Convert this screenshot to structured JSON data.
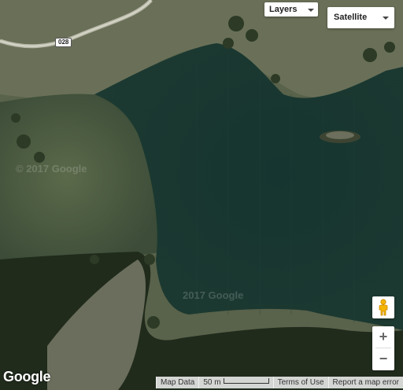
{
  "map": {
    "road_label": "028",
    "watermarks": [
      "© 2017 Google",
      "2017 Google"
    ],
    "map_type_control": {
      "selected": "Satellite"
    },
    "layers_control": {
      "label": "Layers"
    },
    "zoom": {
      "in_label": "+",
      "out_label": "−"
    },
    "logo": "Google",
    "footer": {
      "map_data": "Map Data",
      "scale_label": "50 m",
      "terms": "Terms of Use",
      "report": "Report a map error"
    },
    "colors": {
      "water": "#17342f",
      "land": "#5a6448",
      "forest": "#1f2a1c",
      "shallow": "#4e5a44",
      "pegman": "#f5b400"
    }
  }
}
